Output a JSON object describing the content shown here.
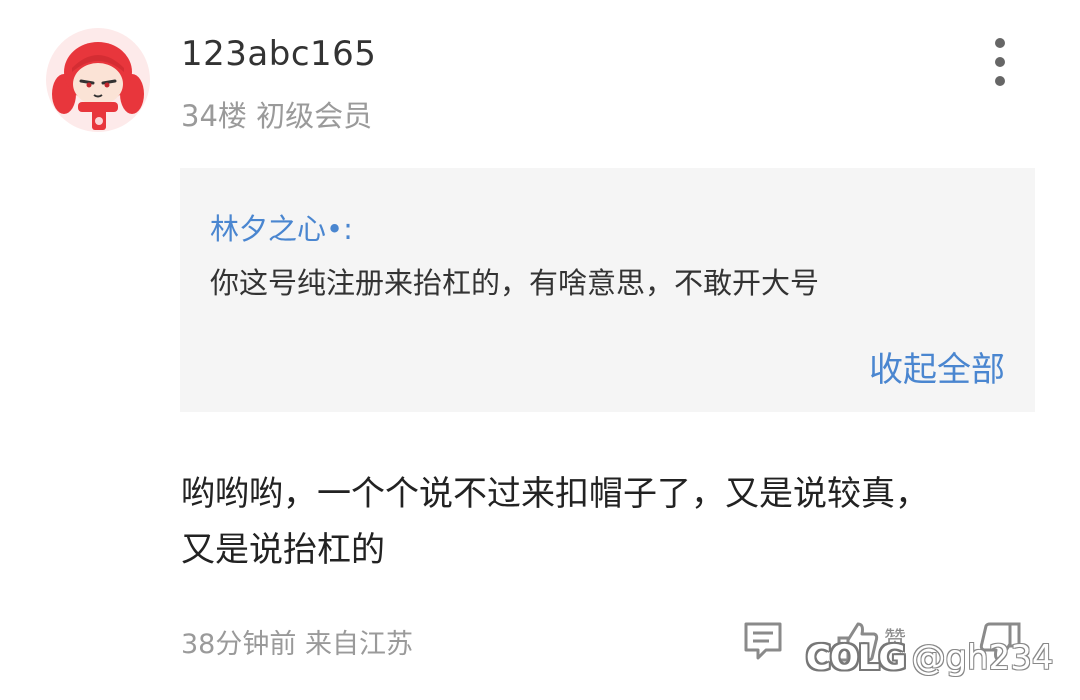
{
  "post": {
    "username": "123abc165",
    "meta": "34楼 初级会员",
    "quote": {
      "author": "林夕之心•:",
      "text": "你这号纯注册来抬杠的，有啥意思，不敢开大号",
      "collapse_label": "收起全部"
    },
    "body_line1": "哟哟哟，一个个说不过来扣帽子了，又是说较真，",
    "body_line2": "又是说抬杠的",
    "footer": "38分钟前 来自江苏",
    "like_label": "赞"
  },
  "icons": {
    "more": "more-vertical-icon",
    "comment": "comment-icon",
    "like": "thumbs-up-icon",
    "dislike": "thumbs-down-icon"
  },
  "watermark": {
    "logo": "COLG",
    "handle": "@gh234"
  },
  "colors": {
    "link": "#4a86d0",
    "quote_bg": "#f5f5f5",
    "avatar_red": "#e8363c"
  }
}
